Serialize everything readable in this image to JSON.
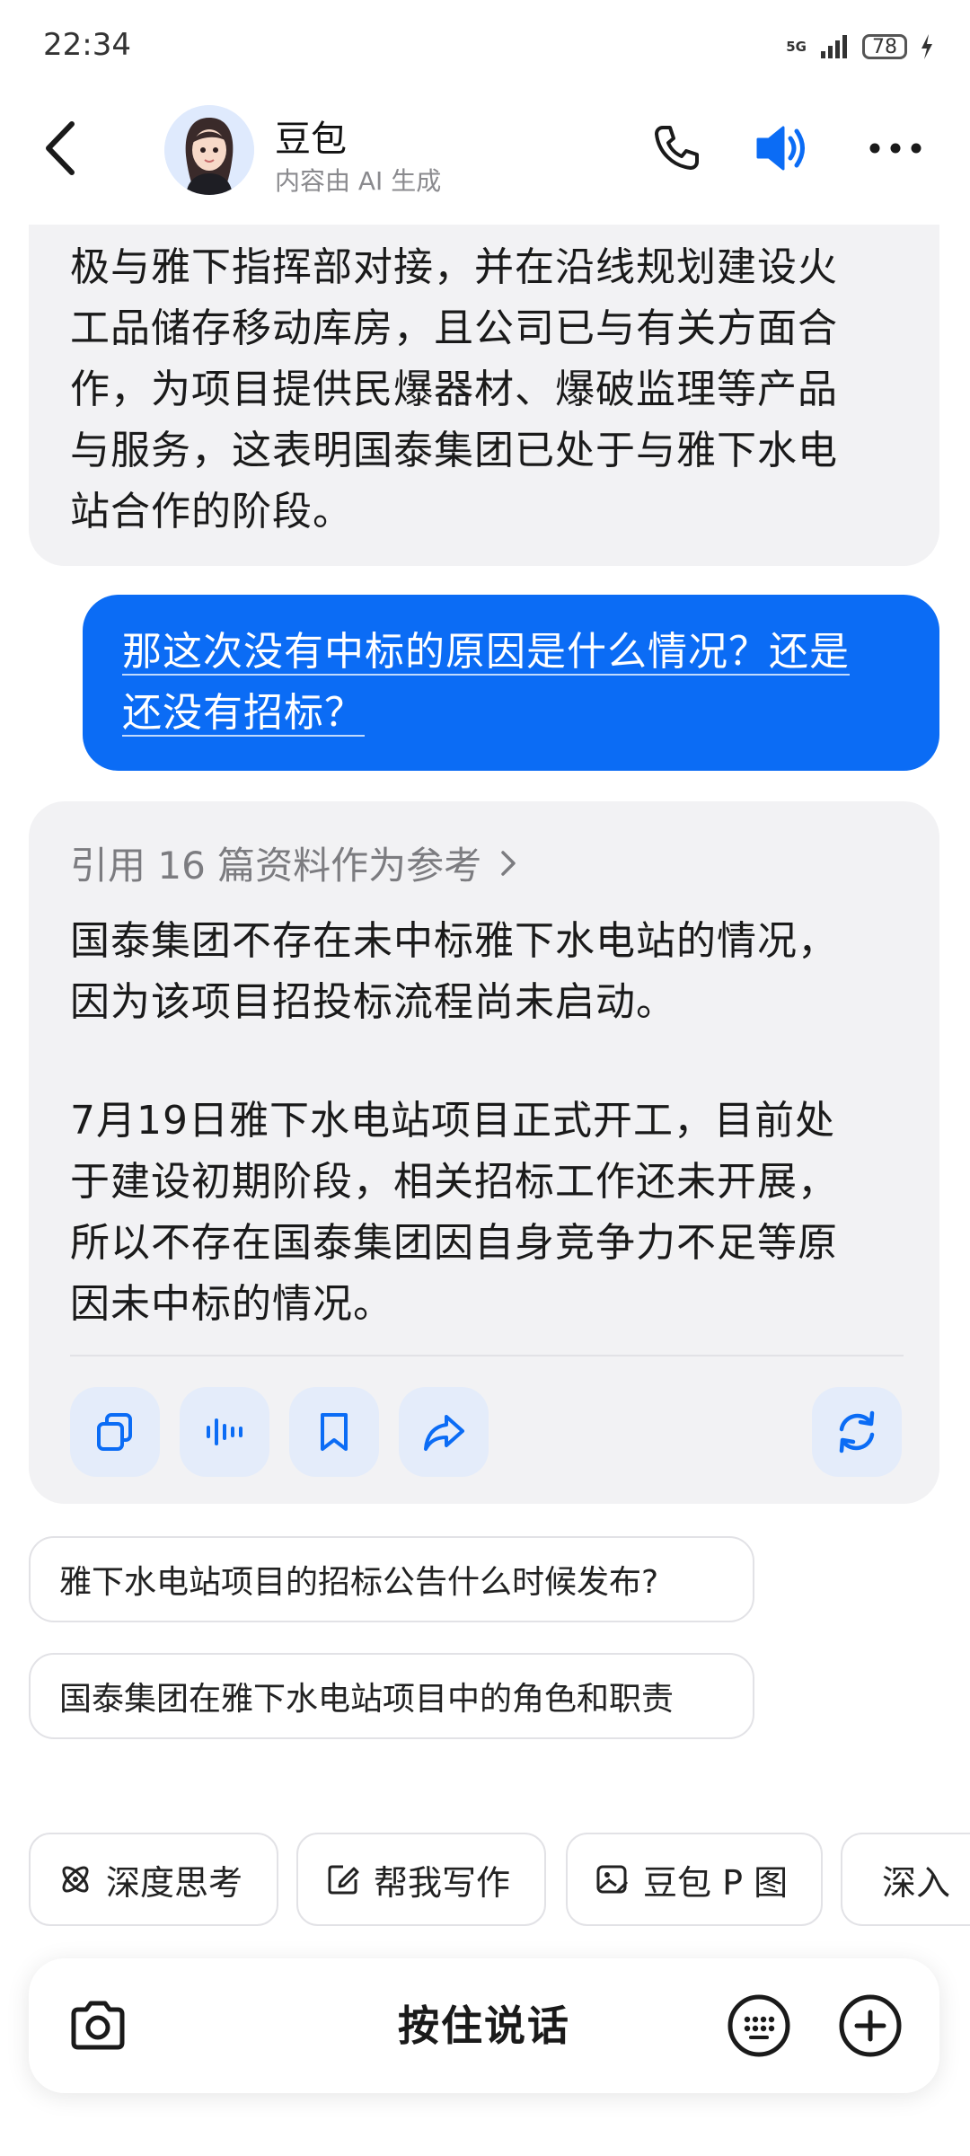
{
  "status_bar": {
    "time": "22:34",
    "network": "5G",
    "battery": "78"
  },
  "header": {
    "name": "豆包",
    "subtitle": "内容由 AI 生成"
  },
  "messages": {
    "ai_top_lines": [
      "极与雅下指挥部对接，并在沿线规划建设火",
      "工品储存移动库房，且公司已与有关方面合",
      "作，为项目提供民爆器材、爆破监理等产品",
      "与服务，这表明国泰集团已处于与雅下水电",
      "站合作的阶段。"
    ],
    "user_lines": [
      "那这次没有中标的原因是什么情况？还是",
      "还没有招标？"
    ],
    "ai_reference": "引用 16 篇资料作为参考",
    "ai_para1_lines": [
      "国泰集团不存在未中标雅下水电站的情况，",
      "因为该项目招投标流程尚未启动。"
    ],
    "ai_para2_lines": [
      "7月19日雅下水电站项目正式开工，目前处",
      "于建设初期阶段，相关招标工作还未开展，",
      "所以不存在国泰集团因自身竞争力不足等原",
      "因未中标的情况。"
    ]
  },
  "suggestions": [
    "雅下水电站项目的招标公告什么时候发布?",
    "国泰集团在雅下水电站项目中的角色和职责"
  ],
  "tools": [
    "深度思考",
    "帮我写作",
    "豆包 P 图",
    "深入"
  ],
  "input": {
    "hold_to_talk": "按住说话"
  },
  "colors": {
    "accent": "#0b6cf5",
    "bubble_gray": "#f2f2f4",
    "action_bg": "#e4ecfa"
  }
}
